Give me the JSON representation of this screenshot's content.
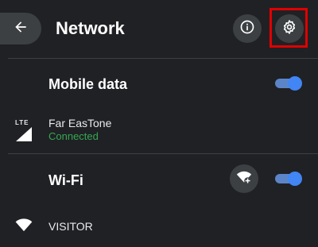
{
  "header": {
    "title": "Network"
  },
  "icons": {
    "back": "arrow-back-icon",
    "info": "info-icon",
    "settings": "gear-icon",
    "lte": "lte-signal-icon",
    "wifi_add": "wifi-add-icon",
    "wifi": "wifi-icon"
  },
  "mobile_data": {
    "label": "Mobile data",
    "enabled": true,
    "carrier": {
      "name": "Far EasTone",
      "status": "Connected",
      "network_type": "LTE"
    }
  },
  "wifi": {
    "label": "Wi-Fi",
    "enabled": true,
    "networks": [
      {
        "name": "VISITOR"
      }
    ]
  },
  "colors": {
    "background": "#202124",
    "connected": "#34a853",
    "toggle_on": "#4285f4",
    "highlight": "#e00000"
  }
}
